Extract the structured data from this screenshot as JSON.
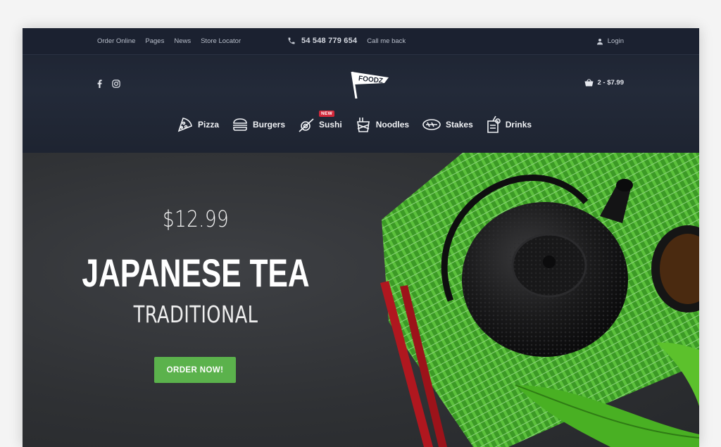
{
  "topbar": {
    "nav": [
      "Order Online",
      "Pages",
      "News",
      "Store Locator"
    ],
    "phone": "54 548 779 654",
    "callback": "Call me back",
    "login": "Login"
  },
  "header": {
    "logo_text": "FOODZ",
    "cart": "2 - $7.99",
    "social": [
      "facebook-icon",
      "instagram-icon"
    ]
  },
  "categories": [
    {
      "label": "Pizza",
      "icon": "pizza-icon"
    },
    {
      "label": "Burgers",
      "icon": "burger-icon"
    },
    {
      "label": "Sushi",
      "icon": "sushi-icon",
      "badge": "NEW"
    },
    {
      "label": "Noodles",
      "icon": "noodles-icon"
    },
    {
      "label": "Stakes",
      "icon": "steak-icon"
    },
    {
      "label": "Drinks",
      "icon": "drinks-icon"
    }
  ],
  "hero": {
    "price": "$12.99",
    "title": "JAPANESE TEA",
    "subtitle": "TRADITIONAL",
    "button": "ORDER NOW!"
  },
  "colors": {
    "header_bg": "#1f2532",
    "accent_green": "#5bb24c",
    "badge_red": "#d3283a",
    "chopsticks_red": "#b0171f",
    "mat_green": "#43a52b"
  }
}
